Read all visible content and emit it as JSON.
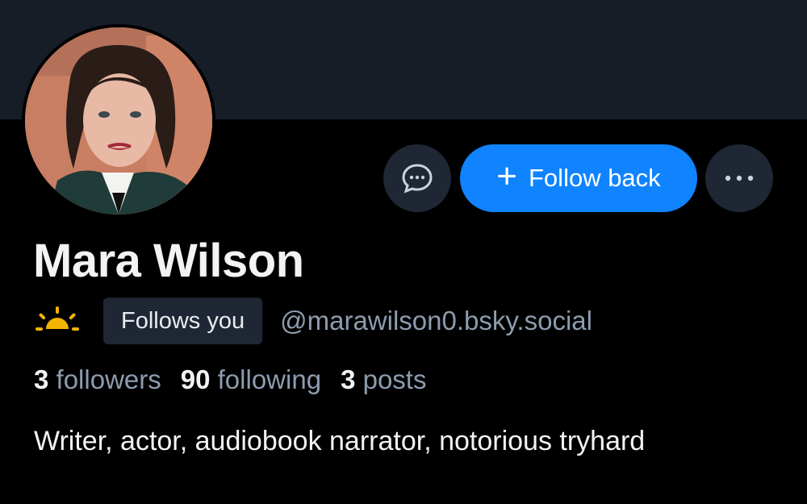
{
  "profile": {
    "name": "Mara Wilson",
    "handle": "@marawilson0.bsky.social",
    "follows_you_label": "Follows you",
    "bio": "Writer, actor, audiobook narrator, notorious tryhard",
    "avatar_icon": "profile-photo"
  },
  "actions": {
    "message_icon": "message-bubble-icon",
    "follow_back_label": "Follow back",
    "follow_plus_icon": "+",
    "more_icon": "ellipsis-icon"
  },
  "stats": [
    {
      "count": "3",
      "label": "followers"
    },
    {
      "count": "90",
      "label": "following"
    },
    {
      "count": "3",
      "label": "posts"
    }
  ],
  "badge_icon": "sunrise-icon",
  "colors": {
    "banner": "#161d27",
    "background": "#000000",
    "accent": "#1083fe",
    "secondary_button": "#1e2733",
    "muted_text": "#8d9caf",
    "sun": "#f5b400"
  }
}
